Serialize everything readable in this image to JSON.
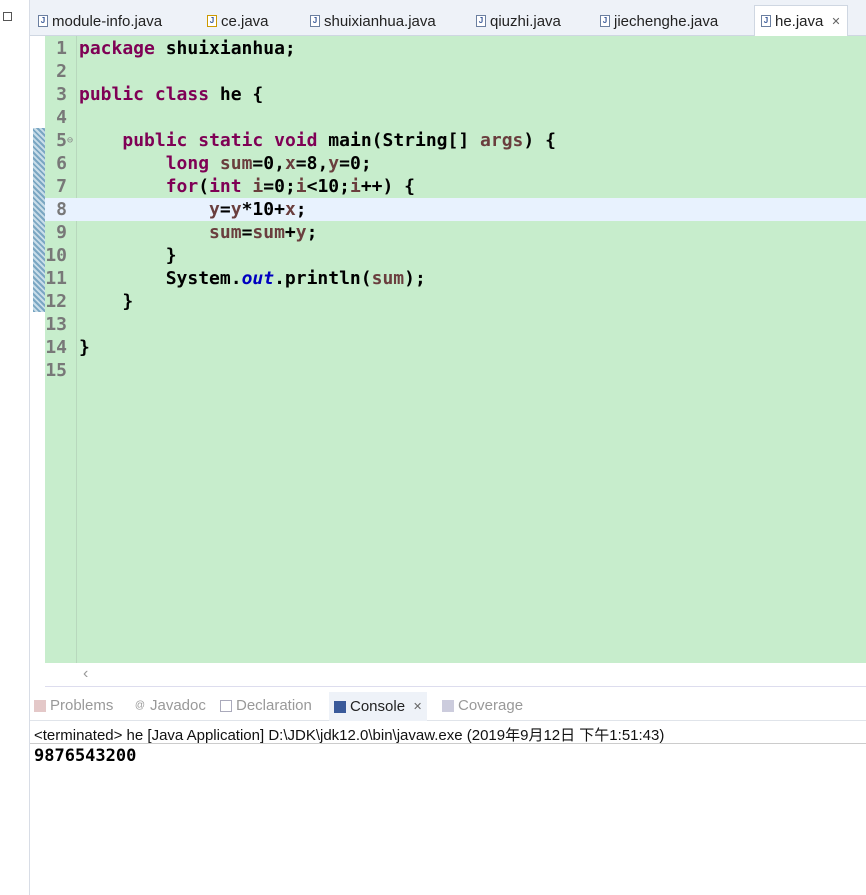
{
  "editor_tabs": [
    {
      "label": "module-info.java"
    },
    {
      "label": "ce.java"
    },
    {
      "label": "shuixianhua.java"
    },
    {
      "label": "qiuzhi.java"
    },
    {
      "label": "jiechenghe.java"
    },
    {
      "label": "he.java",
      "active": true
    }
  ],
  "code_lines": [
    {
      "n": "1",
      "t": [
        [
          "package",
          "kw"
        ],
        [
          " shuixianhua;",
          ""
        ]
      ]
    },
    {
      "n": "2",
      "t": []
    },
    {
      "n": "3",
      "t": [
        [
          "public",
          "kw"
        ],
        [
          " ",
          ""
        ],
        [
          "class",
          "kw"
        ],
        [
          " he {",
          ""
        ]
      ]
    },
    {
      "n": "4",
      "t": []
    },
    {
      "n": "5",
      "t": [
        [
          "    ",
          ""
        ],
        [
          "public",
          "kw"
        ],
        [
          " ",
          ""
        ],
        [
          "static",
          "kw"
        ],
        [
          " ",
          ""
        ],
        [
          "void",
          "kw"
        ],
        [
          " main(String[] ",
          ""
        ],
        [
          "args",
          "var"
        ],
        [
          ") {",
          ""
        ]
      ]
    },
    {
      "n": "6",
      "t": [
        [
          "        ",
          ""
        ],
        [
          "long",
          "kw"
        ],
        [
          " ",
          ""
        ],
        [
          "sum",
          "var"
        ],
        [
          "=0,",
          ""
        ],
        [
          "x",
          "var"
        ],
        [
          "=8,",
          ""
        ],
        [
          "y",
          "var"
        ],
        [
          "=0;",
          ""
        ]
      ]
    },
    {
      "n": "7",
      "t": [
        [
          "        ",
          ""
        ],
        [
          "for",
          "kw"
        ],
        [
          "(",
          ""
        ],
        [
          "int",
          "kw"
        ],
        [
          " ",
          ""
        ],
        [
          "i",
          "var"
        ],
        [
          "=0;",
          ""
        ],
        [
          "i",
          "var"
        ],
        [
          "<10;",
          ""
        ],
        [
          "i",
          "var"
        ],
        [
          "++) {",
          ""
        ]
      ]
    },
    {
      "n": "8",
      "t": [
        [
          "            ",
          ""
        ],
        [
          "y",
          "var"
        ],
        [
          "=",
          ""
        ],
        [
          "y",
          "var"
        ],
        [
          "*10+",
          ""
        ],
        [
          "x",
          "var"
        ],
        [
          ";",
          ""
        ]
      ]
    },
    {
      "n": "9",
      "t": [
        [
          "            ",
          ""
        ],
        [
          "sum",
          "var"
        ],
        [
          "=",
          ""
        ],
        [
          "sum",
          "var"
        ],
        [
          "+",
          ""
        ],
        [
          "y",
          "var"
        ],
        [
          ";",
          ""
        ]
      ]
    },
    {
      "n": "10",
      "t": [
        [
          "        }",
          ""
        ]
      ]
    },
    {
      "n": "11",
      "t": [
        [
          "        System.",
          ""
        ],
        [
          "out",
          "fld"
        ],
        [
          ".println(",
          ""
        ],
        [
          "sum",
          "var"
        ],
        [
          ");",
          ""
        ]
      ]
    },
    {
      "n": "12",
      "t": [
        [
          "    }",
          ""
        ]
      ]
    },
    {
      "n": "13",
      "t": []
    },
    {
      "n": "14",
      "t": [
        [
          "}",
          ""
        ]
      ]
    },
    {
      "n": "15",
      "t": []
    }
  ],
  "current_line": 8,
  "console_tabs": [
    {
      "label": "Problems"
    },
    {
      "label": "Javadoc"
    },
    {
      "label": "Declaration"
    },
    {
      "label": "Console",
      "active": true
    },
    {
      "label": "Coverage"
    }
  ],
  "console": {
    "status": "<terminated> he [Java Application] D:\\JDK\\jdk12.0\\bin\\javaw.exe (2019年9月12日 下午1:51:43)",
    "output": "9876543200"
  }
}
